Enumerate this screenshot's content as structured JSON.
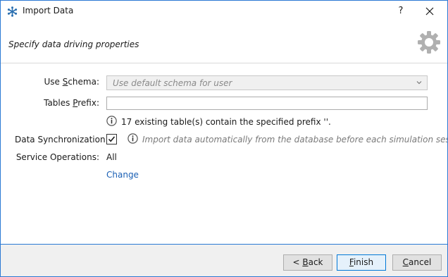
{
  "window": {
    "title": "Import Data",
    "help_label": "?"
  },
  "header": {
    "subtitle": "Specify data driving properties"
  },
  "form": {
    "use_schema": {
      "label_pre": "Use ",
      "label_accel": "S",
      "label_post": "chema:",
      "value": "Use default schema for user"
    },
    "tables_prefix": {
      "label_pre": "Tables ",
      "label_accel": "P",
      "label_post": "refix:",
      "value": ""
    },
    "prefix_info": "17 existing table(s) contain the specified prefix ''.",
    "data_sync": {
      "label": "Data Synchronization:",
      "checked": true,
      "info": "Import data automatically from the database before each simulation session."
    },
    "service_operations": {
      "label": "Service Operations:",
      "value": "All",
      "change_link": "Change"
    }
  },
  "footer": {
    "back": {
      "pre": "< ",
      "accel": "B",
      "post": "ack"
    },
    "finish": {
      "accel": "F",
      "post": "inish"
    },
    "cancel": {
      "accel": "C",
      "post": "ancel"
    }
  },
  "colors": {
    "accent": "#2b79d4",
    "link": "#1a5fb4",
    "info_icon": "#555555",
    "gear": "#b0b0b0"
  },
  "icons": {
    "title": "app-asterisk-icon",
    "help": "question-mark",
    "close": "close-icon",
    "header": "gear-icon",
    "info": "info-icon",
    "dropdown": "chevron-down-icon",
    "checkbox": "checkmark-icon"
  }
}
